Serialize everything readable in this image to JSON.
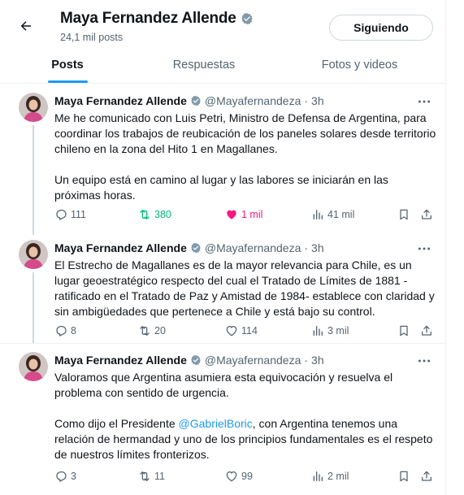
{
  "header": {
    "profile_name": "Maya Fernandez Allende",
    "post_count": "24,1 mil posts",
    "follow_label": "Siguiendo"
  },
  "tabs": [
    {
      "label": "Posts",
      "active": true
    },
    {
      "label": "Respuestas",
      "active": false
    },
    {
      "label": "Fotos y videos",
      "active": false
    }
  ],
  "colors": {
    "accent": "#1d9bf0",
    "retweet_active": "#00ba7c",
    "like_active": "#f91880",
    "muted_text": "#536471"
  },
  "icons": [
    "back-arrow-icon",
    "verified-badge-icon",
    "more-icon",
    "reply-icon",
    "retweet-icon",
    "heart-icon",
    "views-icon",
    "bookmark-icon",
    "share-icon"
  ],
  "tweets": [
    {
      "name": "Maya Fernandez Allende",
      "handle": "@Mayafernandeza",
      "dot": "·",
      "time": "3h",
      "paragraphs": [
        "Me he comunicado con Luis Petri, Ministro de Defensa de Argentina, para coordinar los trabajos de reubicación de los paneles solares desde territorio chileno en la zona del Hito 1 en Magallanes.",
        "Un equipo está en camino al lugar y las labores se iniciarán en las próximas horas."
      ],
      "replies": "111",
      "reposts": "380",
      "likes": "1 mil",
      "views": "41 mil",
      "reposted": true,
      "liked": true
    },
    {
      "name": "Maya Fernandez Allende",
      "handle": "@Mayafernandeza",
      "dot": "·",
      "time": "3h",
      "paragraphs": [
        "El Estrecho de Magallanes es de la mayor relevancia para Chile, es un lugar geoestratégico respecto del cual el Tratado de Límites de 1881 -ratificado en el Tratado de Paz y Amistad de 1984- establece con claridad y sin ambigüedades que pertenece a Chile y está bajo su control."
      ],
      "replies": "8",
      "reposts": "20",
      "likes": "114",
      "views": "3 mil",
      "reposted": false,
      "liked": false
    },
    {
      "name": "Maya Fernandez Allende",
      "handle": "@Mayafernandeza",
      "dot": "·",
      "time": "3h",
      "paragraphs": [
        "Valoramos que Argentina asumiera esta equivocación y resuelva el problema con sentido de urgencia."
      ],
      "para2_before": "Como dijo el Presidente ",
      "mention": "@GabrielBoric",
      "para2_after": ", con Argentina tenemos una relación de hermandad y uno de los principios fundamentales es el respeto de nuestros límites fronterizos.",
      "replies": "3",
      "reposts": "11",
      "likes": "99",
      "views": "2 mil",
      "reposted": false,
      "liked": false
    }
  ]
}
